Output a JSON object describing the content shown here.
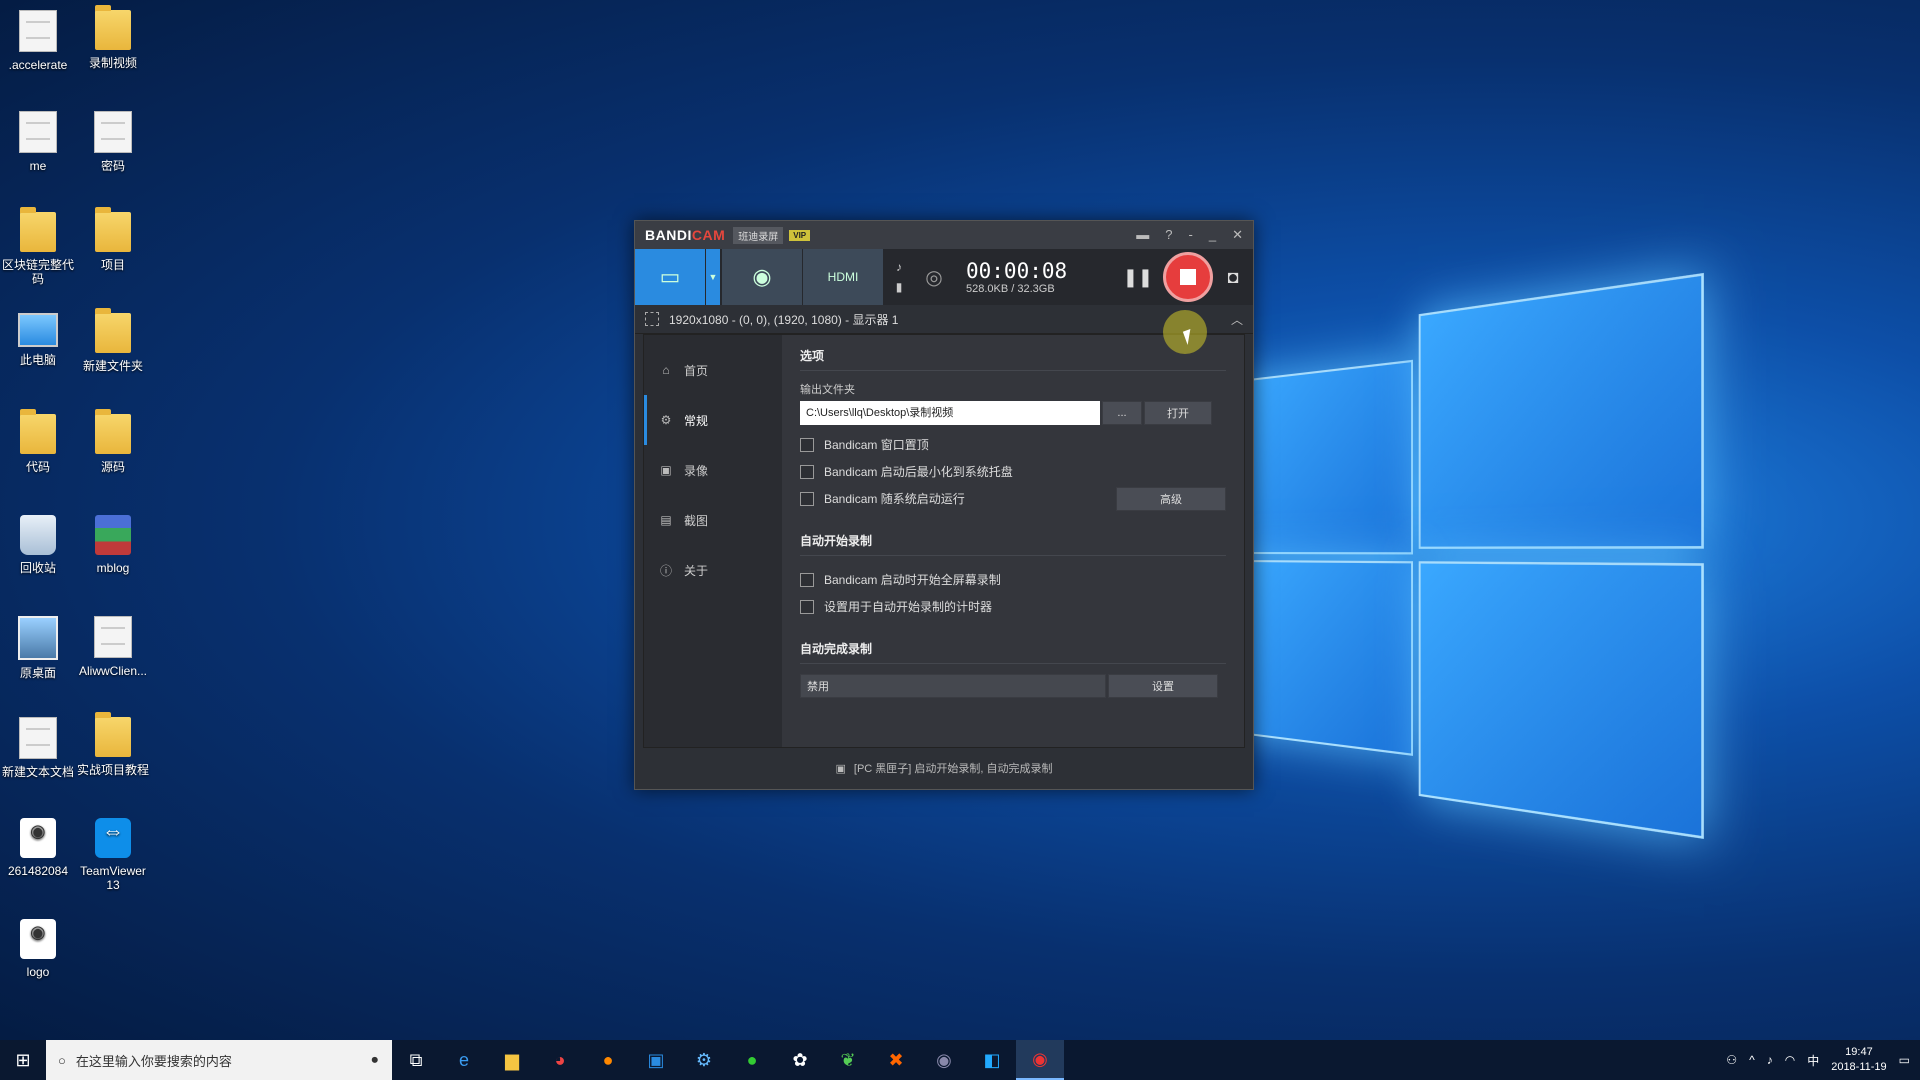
{
  "desktop": {
    "icons": [
      {
        "label": ".accelerate",
        "kind": "file"
      },
      {
        "label": "录制视频",
        "kind": "folder"
      },
      {
        "label": "me",
        "kind": "file"
      },
      {
        "label": "密码",
        "kind": "file"
      },
      {
        "label": "区块链完整代码",
        "kind": "folder"
      },
      {
        "label": "项目",
        "kind": "folder"
      },
      {
        "label": "此电脑",
        "kind": "pc"
      },
      {
        "label": "新建文件夹",
        "kind": "folder"
      },
      {
        "label": "代码",
        "kind": "folder"
      },
      {
        "label": "源码",
        "kind": "folder"
      },
      {
        "label": "回收站",
        "kind": "bin"
      },
      {
        "label": "mblog",
        "kind": "rar"
      },
      {
        "label": "原桌面",
        "kind": "photo"
      },
      {
        "label": "AliwwClien...",
        "kind": "file"
      },
      {
        "label": "新建文本文档",
        "kind": "file"
      },
      {
        "label": "实战项目教程",
        "kind": "folder"
      },
      {
        "label": "261482084",
        "kind": "qq"
      },
      {
        "label": "TeamViewer 13",
        "kind": "tv"
      },
      {
        "label": "logo",
        "kind": "qq"
      }
    ]
  },
  "bandicam": {
    "brand_a": "BANDI",
    "brand_b": "CAM",
    "brand_sub": "班迪录屏",
    "vip": "VIP",
    "timer": "00:00:08",
    "size": "528.0KB / 32.3GB",
    "region": "1920x1080 - (0, 0), (1920, 1080) - 显示器 1",
    "nav": [
      {
        "label": "首页",
        "icon": "home-icon"
      },
      {
        "label": "常规",
        "icon": "gear-icon"
      },
      {
        "label": "录像",
        "icon": "video-icon"
      },
      {
        "label": "截图",
        "icon": "image-icon"
      },
      {
        "label": "关于",
        "icon": "info-icon"
      }
    ],
    "options_title": "选项",
    "output_label": "输出文件夹",
    "output_path": "C:\\Users\\llq\\Desktop\\录制视频",
    "browse_label": "...",
    "open_label": "打开",
    "chk1": "Bandicam 窗口置顶",
    "chk2": "Bandicam 启动后最小化到系统托盘",
    "chk3": "Bandicam 随系统启动运行",
    "advanced_label": "高级",
    "auto_start_title": "自动开始录制",
    "chk4": "Bandicam 启动时开始全屏幕录制",
    "chk5": "设置用于自动开始录制的计时器",
    "auto_finish_title": "自动完成录制",
    "finish_value": "禁用",
    "settings_label": "设置",
    "footer": "[PC 黑匣子] 启动开始录制, 自动完成录制"
  },
  "taskbar": {
    "search_placeholder": "在这里输入你要搜索的内容",
    "time": "19:47",
    "date": "2018-11-19",
    "ime": "中"
  }
}
